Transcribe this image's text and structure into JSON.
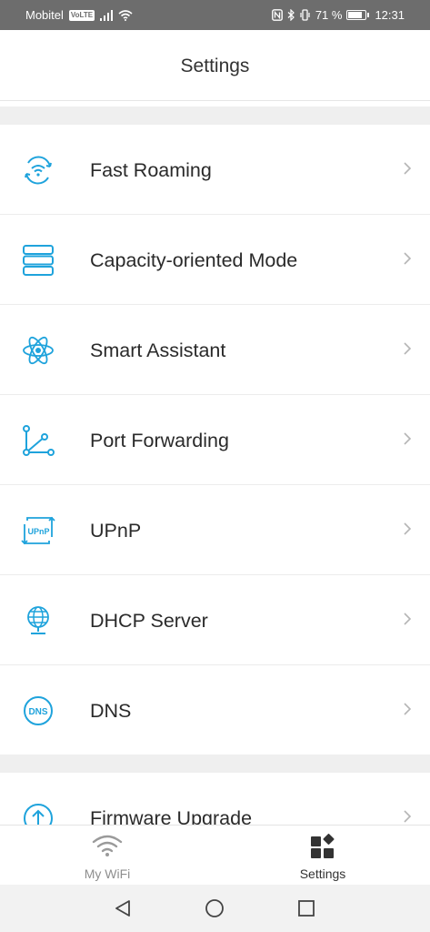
{
  "status_bar": {
    "carrier": "Mobitel",
    "volte": "VoLTE",
    "battery_text": "71 %",
    "battery_level": 0.71,
    "time": "12:31"
  },
  "header": {
    "title": "Settings"
  },
  "settings_items": [
    {
      "label": "Fast Roaming",
      "icon": "fast-roaming-icon"
    },
    {
      "label": "Capacity-oriented Mode",
      "icon": "server-stack-icon"
    },
    {
      "label": "Smart Assistant",
      "icon": "atom-icon"
    },
    {
      "label": "Port Forwarding",
      "icon": "port-forwarding-icon"
    },
    {
      "label": "UPnP",
      "icon": "upnp-icon"
    },
    {
      "label": "DHCP Server",
      "icon": "globe-stand-icon"
    },
    {
      "label": "DNS",
      "icon": "dns-icon"
    }
  ],
  "upnp_icon_text": "UPnP",
  "dns_icon_text": "DNS",
  "settings_items_2": [
    {
      "label": "Firmware Upgrade",
      "icon": "upgrade-arrow-icon"
    }
  ],
  "tab_bar": {
    "tabs": [
      {
        "label": "My WiFi",
        "icon": "wifi-icon",
        "active": false
      },
      {
        "label": "Settings",
        "icon": "settings-grid-icon",
        "active": true
      }
    ]
  },
  "colors": {
    "accent": "#1fa3dc",
    "status_bar": "#6d6d6d",
    "section_gap": "#efefef"
  }
}
